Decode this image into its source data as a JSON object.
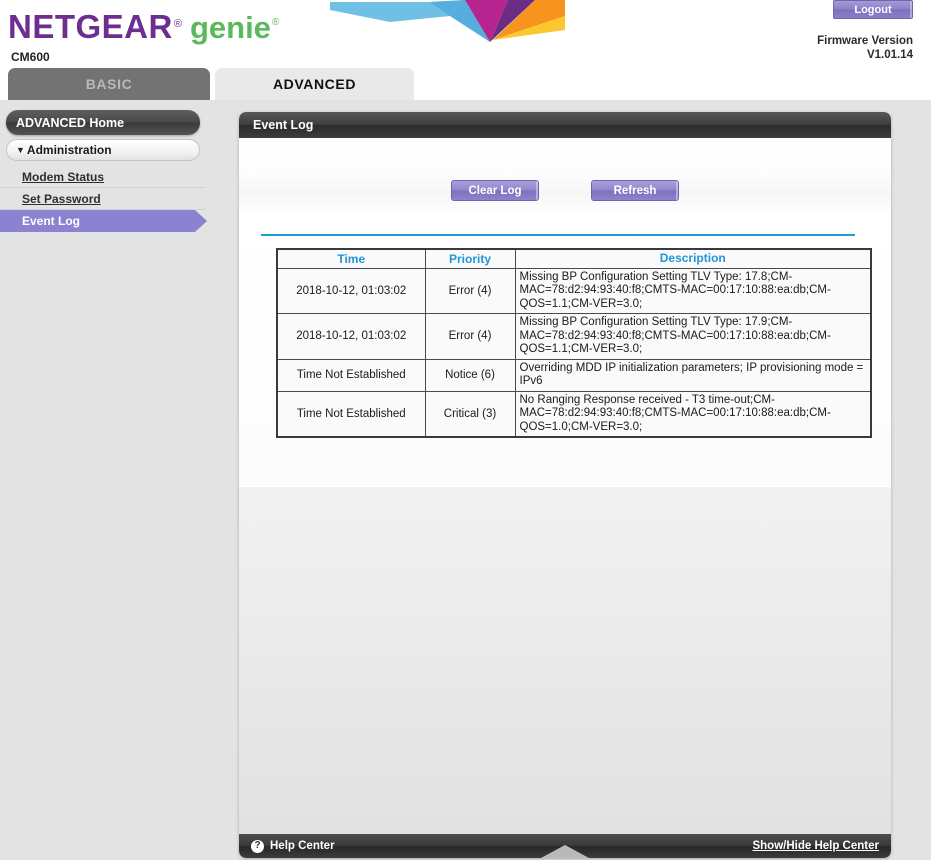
{
  "header": {
    "brand_netgear": "NETGEAR",
    "brand_genie": "genie",
    "registered_mark": "®",
    "model": "CM600",
    "logout_label": "Logout",
    "firmware_label": "Firmware Version",
    "firmware_value": "V1.01.14",
    "colors": {
      "netgear_purple": "#6d2e8f",
      "genie_green": "#5cb85c",
      "deco_blue": "#55aedd",
      "deco_magenta": "#b6248f",
      "deco_purple": "#6b2d83",
      "deco_orange": "#f7941e",
      "deco_yellow": "#fdc82f"
    }
  },
  "tabs": [
    {
      "label": "BASIC",
      "active": false
    },
    {
      "label": "ADVANCED",
      "active": true
    }
  ],
  "sidebar": {
    "home_label": "ADVANCED Home",
    "group_label": "Administration",
    "caret": "▼",
    "items": [
      {
        "label": "Modem Status",
        "active": false
      },
      {
        "label": "Set Password",
        "active": false
      },
      {
        "label": "Event Log",
        "active": true
      }
    ],
    "active_color": "#8b83d1"
  },
  "panel": {
    "title": "Event Log",
    "buttons": {
      "clear_log": "Clear Log",
      "refresh": "Refresh"
    },
    "divider_color": "#1a9fd4"
  },
  "table": {
    "headers": [
      "Time",
      "Priority",
      "Description"
    ],
    "rows": [
      {
        "time": "2018-10-12, 01:03:02",
        "priority": "Error (4)",
        "description": "Missing BP Configuration Setting TLV Type: 17.8;CM-MAC=78:d2:94:93:40:f8;CMTS-MAC=00:17:10:88:ea:db;CM-QOS=1.1;CM-VER=3.0;"
      },
      {
        "time": "2018-10-12, 01:03:02",
        "priority": "Error (4)",
        "description": "Missing BP Configuration Setting TLV Type: 17.9;CM-MAC=78:d2:94:93:40:f8;CMTS-MAC=00:17:10:88:ea:db;CM-QOS=1.1;CM-VER=3.0;"
      },
      {
        "time": "Time Not Established",
        "priority": "Notice (6)",
        "description": "Overriding MDD IP initialization parameters; IP provisioning mode = IPv6"
      },
      {
        "time": "Time Not Established",
        "priority": "Critical (3)",
        "description": "No Ranging Response received - T3 time-out;CM-MAC=78:d2:94:93:40:f8;CMTS-MAC=00:17:10:88:ea:db;CM-QOS=1.0;CM-VER=3.0;"
      }
    ]
  },
  "footer": {
    "help_icon": "?",
    "help_label": "Help Center",
    "toggle_label": "Show/Hide Help Center"
  }
}
